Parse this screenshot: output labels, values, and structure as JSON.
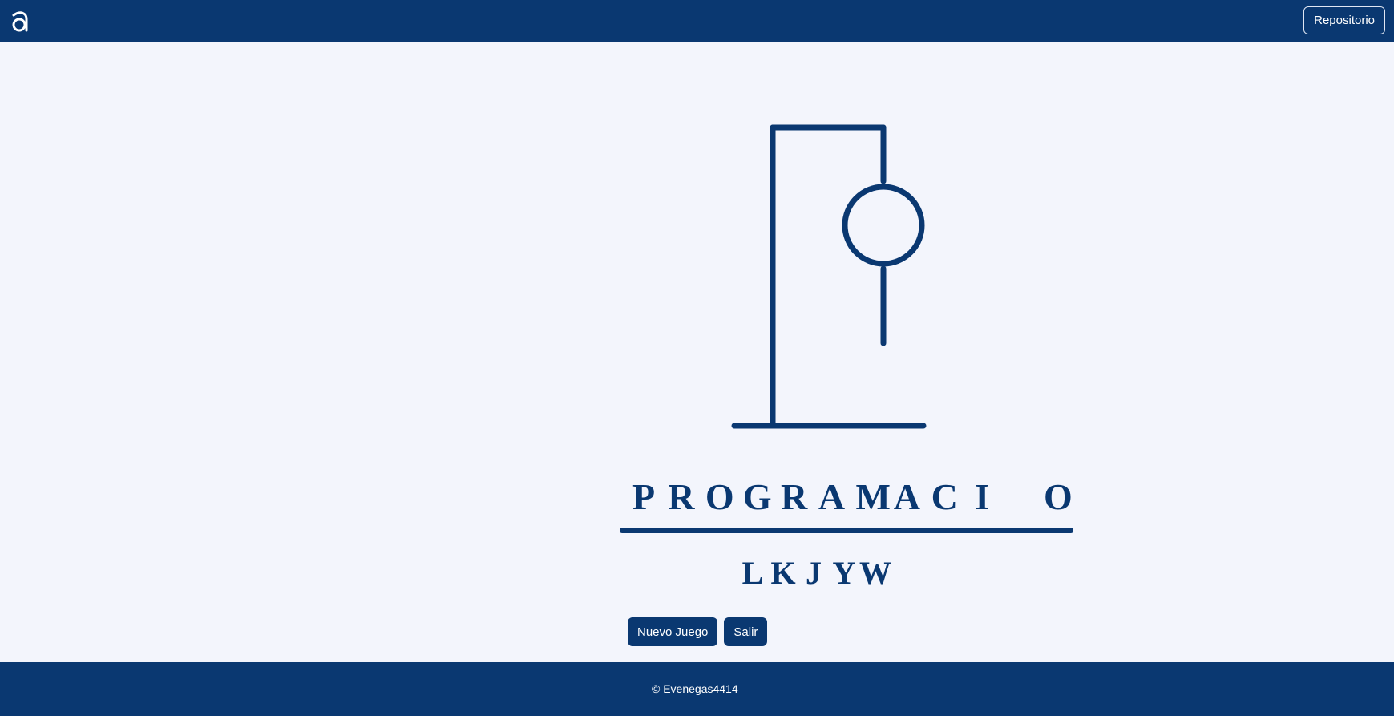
{
  "header": {
    "logo_icon": "alura-logo-icon",
    "repo_label": "Repositorio"
  },
  "game": {
    "secret_word": [
      "P",
      "R",
      "O",
      "G",
      "R",
      "A",
      "M",
      "A",
      "C",
      "I",
      "",
      "O"
    ],
    "wrong_letters": [
      "L",
      "K",
      "J",
      "Y",
      "W"
    ]
  },
  "buttons": {
    "new_game": "Nuevo Juego",
    "exit": "Salir"
  },
  "footer": {
    "copyright": "© Evenegas4414"
  },
  "colors": {
    "primary": "#0a3871",
    "background": "#f3f5fc"
  }
}
